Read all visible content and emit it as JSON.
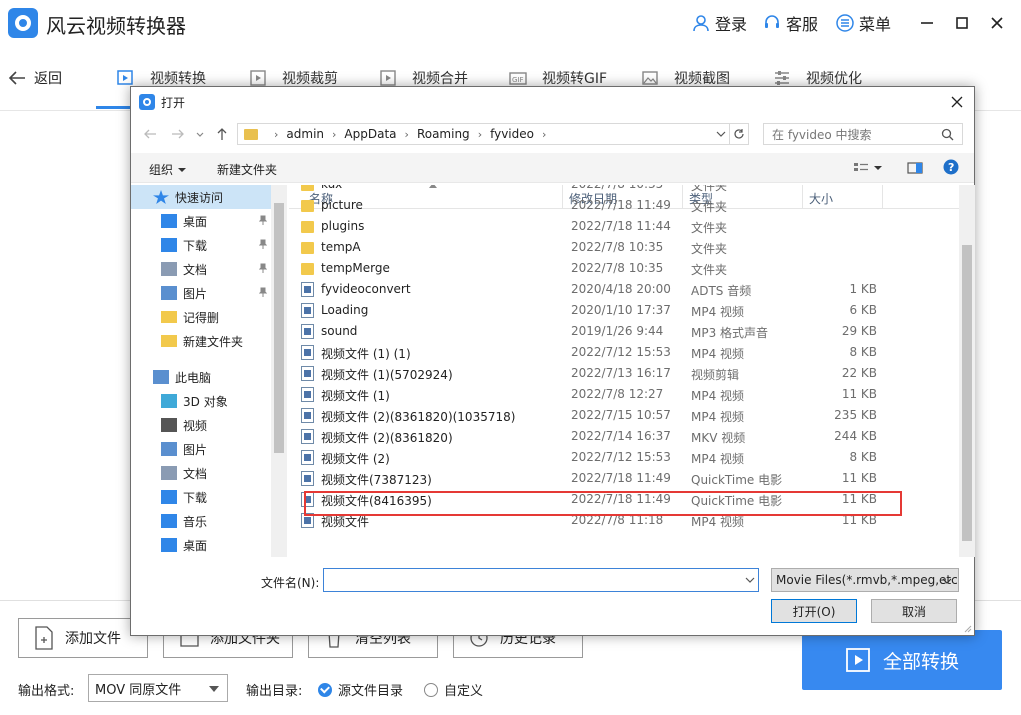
{
  "app": {
    "title": "风云视频转换器",
    "login": "登录",
    "service": "客服",
    "menu": "菜单",
    "back": "返回",
    "tabs": [
      "视频转换",
      "视频裁剪",
      "视频合并",
      "视频转GIF",
      "视频截图",
      "视频优化"
    ],
    "actions": [
      "添加文件",
      "添加文件夹",
      "清空列表",
      "历史记录"
    ],
    "convert_all": "全部转换",
    "output_format_label": "输出格式:",
    "output_format_value": "MOV 同原文件",
    "output_dir_label": "输出目录:",
    "output_dir_options": [
      "源文件目录",
      "自定义"
    ]
  },
  "dialog": {
    "title": "打开",
    "path": [
      "admin",
      "AppData",
      "Roaming",
      "fyvideo"
    ],
    "search_placeholder": "在 fyvideo 中搜索",
    "toolbar": {
      "organize": "组织",
      "new_folder": "新建文件夹"
    },
    "tree": [
      {
        "label": "快速访问",
        "icon": "star-icon"
      },
      {
        "label": "桌面",
        "icon": "desktop-icon"
      },
      {
        "label": "下载",
        "icon": "download-icon"
      },
      {
        "label": "文档",
        "icon": "document-icon"
      },
      {
        "label": "图片",
        "icon": "picture-icon"
      },
      {
        "label": "记得删",
        "icon": "folder-icon"
      },
      {
        "label": "新建文件夹",
        "icon": "folder-icon"
      },
      {
        "label": "此电脑",
        "icon": "computer-icon"
      },
      {
        "label": "3D 对象",
        "icon": "cube-icon"
      },
      {
        "label": "视频",
        "icon": "video-icon"
      },
      {
        "label": "图片",
        "icon": "picture-icon"
      },
      {
        "label": "文档",
        "icon": "document-icon"
      },
      {
        "label": "下载",
        "icon": "download-icon"
      },
      {
        "label": "音乐",
        "icon": "music-icon"
      },
      {
        "label": "桌面",
        "icon": "desktop-icon"
      }
    ],
    "columns": [
      "名称",
      "修改日期",
      "类型",
      "大小"
    ],
    "rows": [
      {
        "name": "kux",
        "date": "2022/7/8 10:35",
        "type": "文件夹",
        "size": "",
        "kind": "folder"
      },
      {
        "name": "picture",
        "date": "2022/7/18 11:49",
        "type": "文件夹",
        "size": "",
        "kind": "folder"
      },
      {
        "name": "plugins",
        "date": "2022/7/18 11:44",
        "type": "文件夹",
        "size": "",
        "kind": "folder"
      },
      {
        "name": "tempA",
        "date": "2022/7/8 10:35",
        "type": "文件夹",
        "size": "",
        "kind": "folder"
      },
      {
        "name": "tempMerge",
        "date": "2022/7/8 10:35",
        "type": "文件夹",
        "size": "",
        "kind": "folder"
      },
      {
        "name": "fyvideoconvert",
        "date": "2020/4/18 20:00",
        "type": "ADTS 音频",
        "size": "1 KB",
        "kind": "file"
      },
      {
        "name": "Loading",
        "date": "2020/1/10 17:37",
        "type": "MP4 视频",
        "size": "6 KB",
        "kind": "file"
      },
      {
        "name": "sound",
        "date": "2019/1/26 9:44",
        "type": "MP3 格式声音",
        "size": "29 KB",
        "kind": "file"
      },
      {
        "name": "视频文件 (1) (1)",
        "date": "2022/7/12 15:53",
        "type": "MP4 视频",
        "size": "8 KB",
        "kind": "file"
      },
      {
        "name": "视频文件 (1)(5702924)",
        "date": "2022/7/13 16:17",
        "type": "视频剪辑",
        "size": "22 KB",
        "kind": "file"
      },
      {
        "name": "视频文件 (1)",
        "date": "2022/7/8 12:27",
        "type": "MP4 视频",
        "size": "11 KB",
        "kind": "file"
      },
      {
        "name": "视频文件 (2)(8361820)(1035718)",
        "date": "2022/7/15 10:57",
        "type": "MP4 视频",
        "size": "235 KB",
        "kind": "file"
      },
      {
        "name": "视频文件 (2)(8361820)",
        "date": "2022/7/14 16:37",
        "type": "MKV 视频",
        "size": "244 KB",
        "kind": "file"
      },
      {
        "name": "视频文件 (2)",
        "date": "2022/7/12 15:53",
        "type": "MP4 视频",
        "size": "8 KB",
        "kind": "file"
      },
      {
        "name": "视频文件(7387123)",
        "date": "2022/7/18 11:49",
        "type": "QuickTime 电影",
        "size": "11 KB",
        "kind": "file"
      },
      {
        "name": "视频文件(8416395)",
        "date": "2022/7/18 11:49",
        "type": "QuickTime 电影",
        "size": "11 KB",
        "kind": "file"
      },
      {
        "name": "视频文件",
        "date": "2022/7/8 11:18",
        "type": "MP4 视频",
        "size": "11 KB",
        "kind": "file"
      }
    ],
    "filename_label": "文件名(N):",
    "filename_value": "",
    "filetype_value": "Movie Files(*.rmvb,*.mpeg,etc)",
    "open_button": "打开(O)",
    "cancel_button": "取消"
  }
}
